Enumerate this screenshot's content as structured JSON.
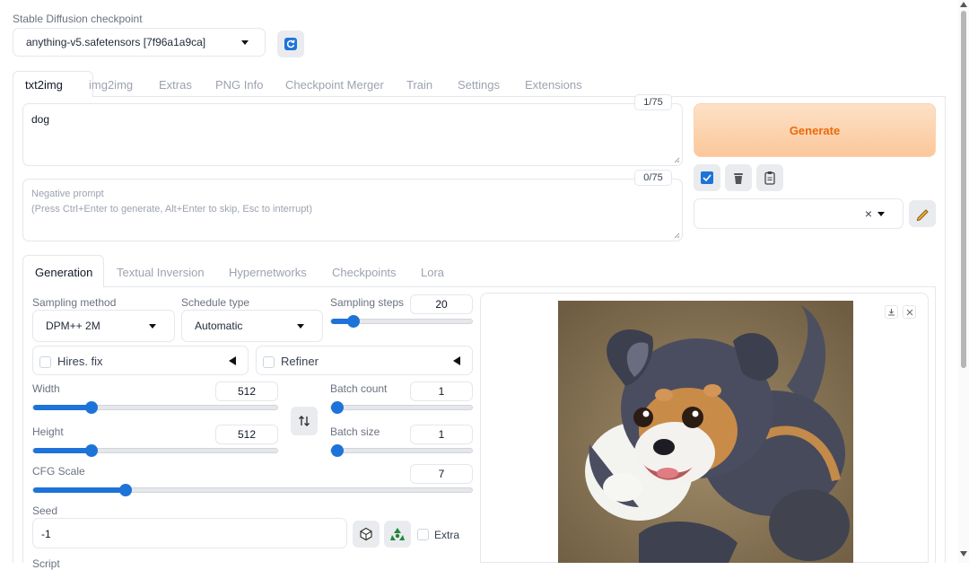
{
  "checkpoint": {
    "label": "Stable Diffusion checkpoint",
    "value": "anything-v5.safetensors [7f96a1a9ca]",
    "refresh_icon": "refresh-icon"
  },
  "main_tabs": [
    "txt2img",
    "img2img",
    "Extras",
    "PNG Info",
    "Checkpoint Merger",
    "Train",
    "Settings",
    "Extensions"
  ],
  "prompt": {
    "value": "dog",
    "counter": "1/75"
  },
  "negative_prompt": {
    "placeholder_line1": "Negative prompt",
    "placeholder_line2": "(Press Ctrl+Enter to generate, Alt+Enter to skip, Esc to interrupt)",
    "counter": "0/75"
  },
  "generate": {
    "label": "Generate",
    "color": "#f97316"
  },
  "style_dropdown": {
    "clear": "×"
  },
  "sub_tabs": [
    "Generation",
    "Textual Inversion",
    "Hypernetworks",
    "Checkpoints",
    "Lora"
  ],
  "sampling": {
    "method_label": "Sampling method",
    "method_value": "DPM++ 2M",
    "schedule_label": "Schedule type",
    "schedule_value": "Automatic",
    "steps_label": "Sampling steps",
    "steps_value": "20",
    "steps_fraction": 0.16
  },
  "hires": {
    "label": "Hires. fix"
  },
  "refiner": {
    "label": "Refiner"
  },
  "width": {
    "label": "Width",
    "value": "512",
    "fraction": 0.24
  },
  "height": {
    "label": "Height",
    "value": "512",
    "fraction": 0.24
  },
  "batch_count": {
    "label": "Batch count",
    "value": "1",
    "fraction": 0.0
  },
  "batch_size": {
    "label": "Batch size",
    "value": "1",
    "fraction": 0.0
  },
  "cfg": {
    "label": "CFG Scale",
    "value": "7",
    "fraction": 0.21
  },
  "seed": {
    "label": "Seed",
    "value": "-1",
    "extra_label": "Extra"
  },
  "script_label": "Script",
  "accent": "#1e73d8"
}
